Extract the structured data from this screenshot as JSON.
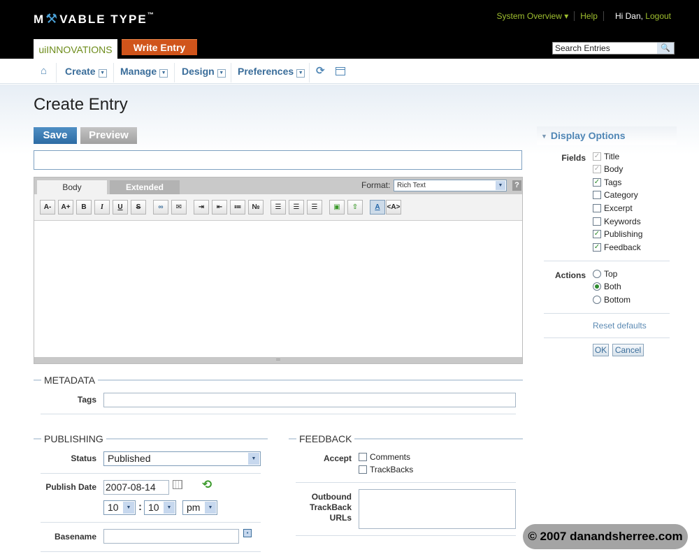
{
  "header": {
    "logo_text_a": "M",
    "logo_text_b": "VABLE TYPE",
    "logo_tm": "™",
    "system_overview": "System Overview",
    "help": "Help",
    "greeting": "Hi Dan,",
    "logout": "Logout",
    "blog_name": "uiINNOVATIONS",
    "write_entry": "Write Entry",
    "search_value": "Search Entries"
  },
  "nav": {
    "create": "Create",
    "manage": "Manage",
    "design": "Design",
    "preferences": "Preferences"
  },
  "page": {
    "title": "Create Entry",
    "save": "Save",
    "preview": "Preview"
  },
  "editor": {
    "tab_body": "Body",
    "tab_extended": "Extended",
    "format_label": "Format:",
    "format_value": "Rich Text",
    "help": "?"
  },
  "metadata": {
    "heading": "METADATA",
    "tags_label": "Tags"
  },
  "publishing": {
    "heading": "PUBLISHING",
    "status_label": "Status",
    "status_value": "Published",
    "publish_date_label": "Publish Date",
    "date_value": "2007-08-14",
    "hour": "10",
    "minute": "10",
    "colon": ":",
    "ampm": "pm",
    "basename_label": "Basename"
  },
  "feedback": {
    "heading": "FEEDBACK",
    "accept_label": "Accept",
    "comments": "Comments",
    "trackbacks": "TrackBacks",
    "outbound_1": "Outbound",
    "outbound_2": "TrackBack",
    "outbound_3": "URLs"
  },
  "display_options": {
    "heading": "Display Options",
    "fields_label": "Fields",
    "fields": [
      {
        "label": "Title",
        "checked": true,
        "disabled": true
      },
      {
        "label": "Body",
        "checked": true,
        "disabled": true
      },
      {
        "label": "Tags",
        "checked": true,
        "disabled": false
      },
      {
        "label": "Category",
        "checked": false,
        "disabled": false
      },
      {
        "label": "Excerpt",
        "checked": false,
        "disabled": false
      },
      {
        "label": "Keywords",
        "checked": false,
        "disabled": false
      },
      {
        "label": "Publishing",
        "checked": true,
        "disabled": false
      },
      {
        "label": "Feedback",
        "checked": true,
        "disabled": false
      }
    ],
    "actions_label": "Actions",
    "actions": [
      "Top",
      "Both",
      "Bottom"
    ],
    "actions_selected": "Both",
    "reset": "Reset defaults",
    "ok": "OK",
    "cancel": "Cancel"
  },
  "watermark": "© 2007 danandsherree.com",
  "colors": {
    "accent_green": "#9fbf2f",
    "link_blue": "#3a6d9a",
    "write_orange": "#d0541b",
    "save_blue": "#2c6ba4"
  }
}
